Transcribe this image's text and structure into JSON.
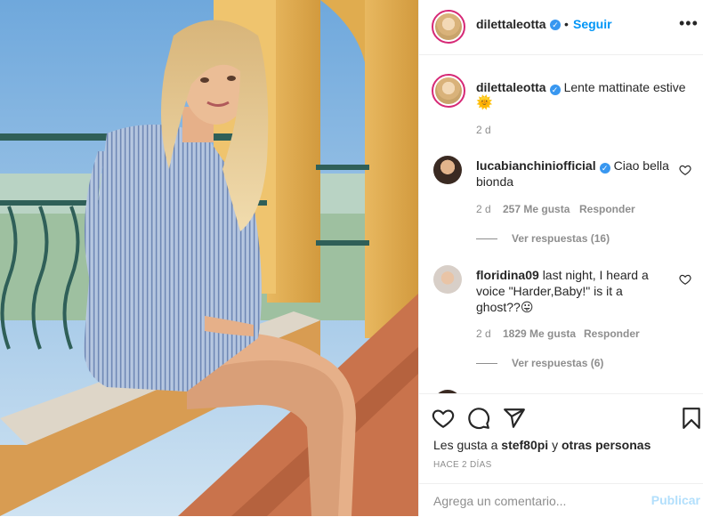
{
  "header": {
    "username": "dilettaleotta",
    "verified_mark": "✓",
    "separator": "•",
    "follow_label": "Seguir",
    "more_label": "•••"
  },
  "caption": {
    "username": "dilettaleotta",
    "text": "Lente mattinate estive",
    "emoji": "🌞",
    "time": "2 d"
  },
  "comments": [
    {
      "username": "lucabianchiniofficial",
      "text_line1": "Ciao bella",
      "text_line2": "bionda",
      "time": "2 d",
      "likes": "257 Me gusta",
      "reply_label": "Responder",
      "view_replies": "Ver respuestas (16)"
    },
    {
      "username": "floridina09",
      "text_line1": "last night, I heard a",
      "text_line2": "voice \"Harder,Baby!\" is it a",
      "text_line3": "ghost??",
      "emoji": "😛",
      "time": "2 d",
      "likes": "1829 Me gusta",
      "reply_label": "Responder",
      "view_replies": "Ver respuestas (6)"
    }
  ],
  "likes_line": {
    "prefix": "Les gusta a",
    "user": "stef80pi",
    "middle": "y",
    "suffix": "otras personas"
  },
  "time_ago": "HACE 2 DÍAS",
  "add_comment": {
    "placeholder": "Agrega un comentario...",
    "publish_label": "Publicar"
  },
  "icons": {
    "like": "heart-icon",
    "comment": "comment-bubble-icon",
    "share": "paper-plane-icon",
    "save": "bookmark-icon"
  },
  "colors": {
    "link_blue": "#0095f6",
    "verified_blue": "#3897f0",
    "story_ring": "#d62976",
    "muted_text": "#8e8e8e",
    "publish_disabled": "#b2dffc"
  }
}
